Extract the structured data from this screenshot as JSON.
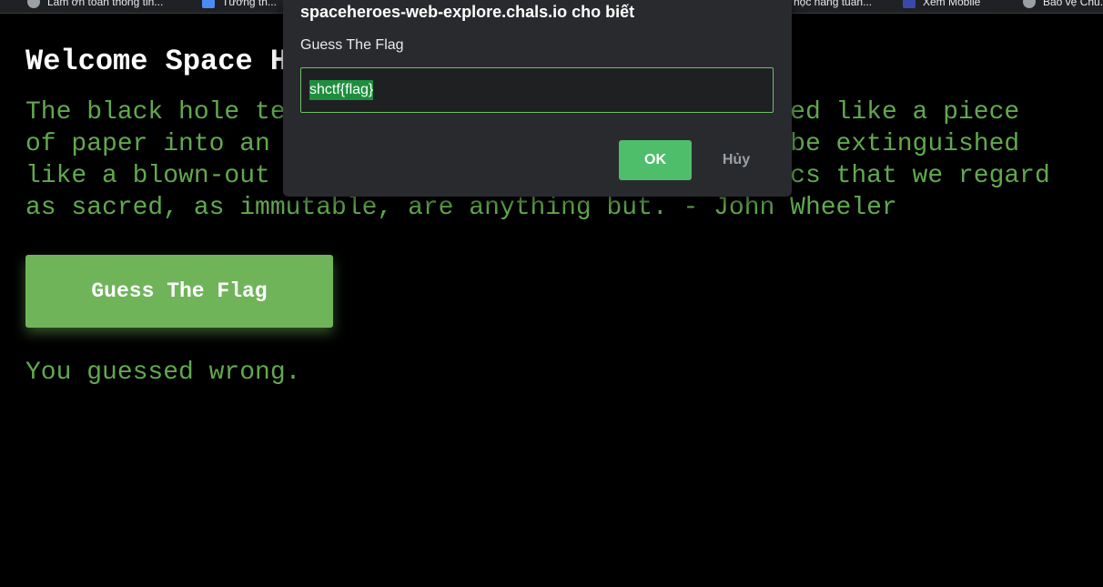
{
  "bookmarks": [
    {
      "label": "Làm ơn toán thông tin..."
    },
    {
      "label": "Tường th..."
    },
    {
      "label": "học năng tuần..."
    },
    {
      "label": "Xem Mobile"
    },
    {
      "label": "Bảo vệ Chủ..."
    }
  ],
  "page": {
    "title": "Welcome Space Heroes",
    "quote": "The black hole teaches us that space can be crumpled like a piece of paper into an infinitesimal dot, that time can be extinguished like a blown-out flame, and that the laws of physics that we regard as sacred, as immutable, are anything but. - John Wheeler",
    "button_label": "Guess The Flag",
    "result_text": "You guessed wrong."
  },
  "dialog": {
    "title": "spaceheroes-web-explore.chals.io cho biết",
    "message": "Guess The Flag",
    "input_value": "shctf{flag}",
    "ok_label": "OK",
    "cancel_label": "Hủy"
  },
  "colors": {
    "page_background": "#000000",
    "text_green": "#62a84f",
    "button_green": "#70b45a",
    "dialog_background": "#292a2d",
    "ok_green": "#4fbe6b"
  }
}
